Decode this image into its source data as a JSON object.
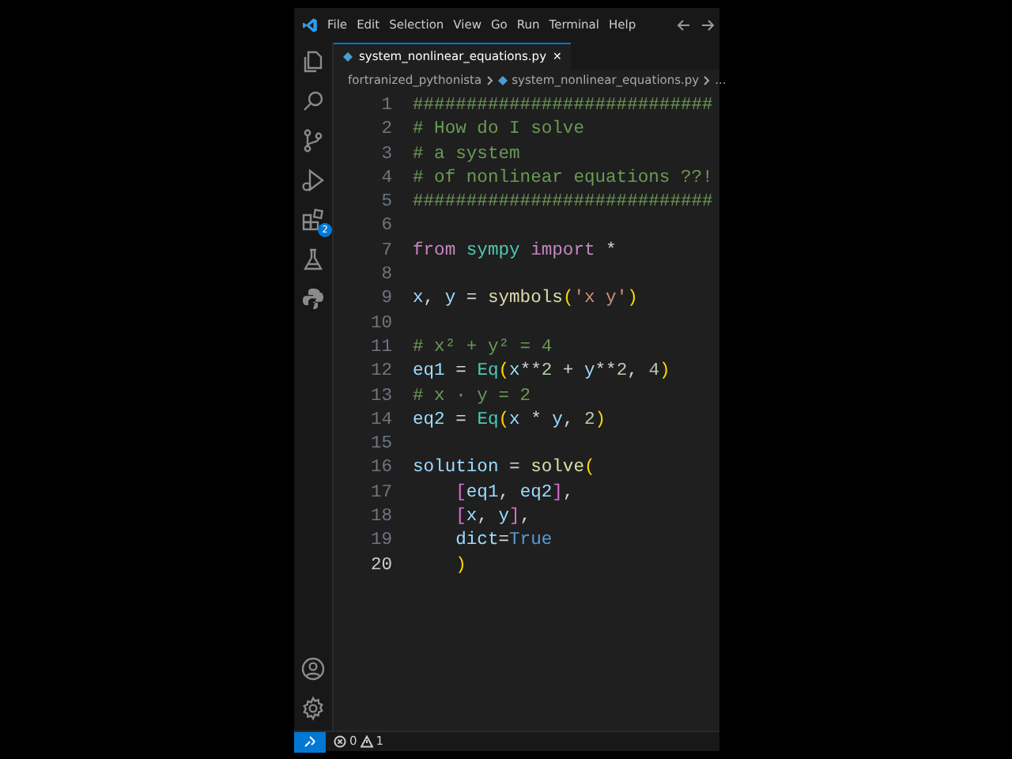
{
  "menu": [
    "File",
    "Edit",
    "Selection",
    "View",
    "Go",
    "Run",
    "Terminal",
    "Help"
  ],
  "activity_bar": [
    {
      "kind": "files"
    },
    {
      "kind": "search"
    },
    {
      "kind": "source-control"
    },
    {
      "kind": "run"
    },
    {
      "kind": "extensions",
      "badge": "2"
    },
    {
      "kind": "testing"
    },
    {
      "kind": "python"
    }
  ],
  "tabs": [
    {
      "label": "system_nonlinear_equations.py",
      "selected": true,
      "close": "✕"
    }
  ],
  "breadcrumb": {
    "folder": "fortranized_pythonista",
    "file": "system_nonlinear_equations.py",
    "more": "..."
  },
  "lines": [
    {
      "number": "1",
      "current": false,
      "tokens": [
        {
          "kind": "comment",
          "text": "############################"
        }
      ]
    },
    {
      "number": "2",
      "current": false,
      "tokens": [
        {
          "kind": "comment",
          "text": "# How do I solve"
        }
      ]
    },
    {
      "number": "3",
      "current": false,
      "tokens": [
        {
          "kind": "comment",
          "text": "# a system"
        }
      ]
    },
    {
      "number": "4",
      "current": false,
      "tokens": [
        {
          "kind": "comment",
          "text": "# of nonlinear equations ??!"
        }
      ]
    },
    {
      "number": "5",
      "current": false,
      "tokens": [
        {
          "kind": "comment",
          "text": "############################"
        }
      ]
    },
    {
      "number": "6",
      "current": false
    },
    {
      "number": "7",
      "current": false,
      "tokens": [
        {
          "kind": "keyword",
          "text": "from"
        },
        {
          "kind": "module",
          "text": " sympy"
        },
        {
          "kind": "keyword",
          "text": " import"
        },
        {
          "kind": "plain",
          "text": " *"
        }
      ]
    },
    {
      "number": "8",
      "current": false
    },
    {
      "number": "9",
      "current": false,
      "tokens": [
        {
          "kind": "var",
          "text": "x"
        },
        {
          "kind": "plain",
          "text": ", "
        },
        {
          "kind": "var",
          "text": "y"
        },
        {
          "kind": "plain",
          "text": " = "
        },
        {
          "kind": "func",
          "text": "symbols"
        },
        {
          "kind": "paren",
          "text": "("
        },
        {
          "kind": "string",
          "text": "'x y'"
        },
        {
          "kind": "paren",
          "text": ")"
        }
      ]
    },
    {
      "number": "10",
      "current": false
    },
    {
      "number": "11",
      "current": false,
      "tokens": [
        {
          "kind": "comment",
          "text": "# x² + y² = 4"
        }
      ]
    },
    {
      "number": "12",
      "current": false,
      "tokens": [
        {
          "kind": "var",
          "text": "eq1"
        },
        {
          "kind": "plain",
          "text": " = "
        },
        {
          "kind": "module",
          "text": "Eq"
        },
        {
          "kind": "paren",
          "text": "("
        },
        {
          "kind": "var",
          "text": "x"
        },
        {
          "kind": "plain",
          "text": "**"
        },
        {
          "kind": "number",
          "text": "2"
        },
        {
          "kind": "plain",
          "text": " + "
        },
        {
          "kind": "var",
          "text": "y"
        },
        {
          "kind": "plain",
          "text": "**"
        },
        {
          "kind": "number",
          "text": "2"
        },
        {
          "kind": "plain",
          "text": ", "
        },
        {
          "kind": "number",
          "text": "4"
        },
        {
          "kind": "paren",
          "text": ")"
        }
      ]
    },
    {
      "number": "13",
      "current": false,
      "tokens": [
        {
          "kind": "comment",
          "text": "# x · y = 2"
        }
      ]
    },
    {
      "number": "14",
      "current": false,
      "tokens": [
        {
          "kind": "var",
          "text": "eq2"
        },
        {
          "kind": "plain",
          "text": " = "
        },
        {
          "kind": "module",
          "text": "Eq"
        },
        {
          "kind": "paren",
          "text": "("
        },
        {
          "kind": "var",
          "text": "x"
        },
        {
          "kind": "plain",
          "text": " * "
        },
        {
          "kind": "var",
          "text": "y"
        },
        {
          "kind": "plain",
          "text": ", "
        },
        {
          "kind": "number",
          "text": "2"
        },
        {
          "kind": "paren",
          "text": ")"
        }
      ]
    },
    {
      "number": "15",
      "current": false
    },
    {
      "number": "16",
      "current": false,
      "tokens": [
        {
          "kind": "var",
          "text": "solution"
        },
        {
          "kind": "plain",
          "text": " = "
        },
        {
          "kind": "func",
          "text": "solve"
        },
        {
          "kind": "paren",
          "text": "("
        }
      ]
    },
    {
      "number": "17",
      "current": false,
      "tokens": [
        {
          "kind": "bracket",
          "text": "    ["
        },
        {
          "kind": "var",
          "text": "eq1"
        },
        {
          "kind": "plain",
          "text": ", "
        },
        {
          "kind": "var",
          "text": "eq2"
        },
        {
          "kind": "bracket",
          "text": "]"
        },
        {
          "kind": "plain",
          "text": ","
        }
      ]
    },
    {
      "number": "18",
      "current": false,
      "tokens": [
        {
          "kind": "bracket",
          "text": "    ["
        },
        {
          "kind": "var",
          "text": "x"
        },
        {
          "kind": "plain",
          "text": ", "
        },
        {
          "kind": "var",
          "text": "y"
        },
        {
          "kind": "bracket",
          "text": "]"
        },
        {
          "kind": "plain",
          "text": ","
        }
      ]
    },
    {
      "number": "19",
      "current": false,
      "tokens": [
        {
          "kind": "var",
          "text": "    dict"
        },
        {
          "kind": "plain",
          "text": "="
        },
        {
          "kind": "const",
          "text": "True"
        }
      ]
    },
    {
      "number": "20",
      "current": true,
      "tokens": [
        {
          "kind": "paren",
          "text": "    )"
        }
      ]
    }
  ],
  "status_bar": {
    "errors": "0",
    "warnings": "1"
  }
}
